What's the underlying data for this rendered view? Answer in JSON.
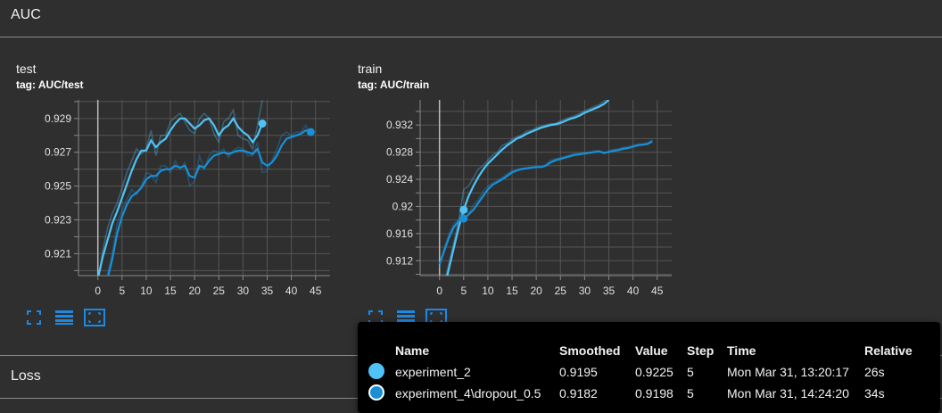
{
  "sections": {
    "auc_title": "AUC",
    "loss_title": "Loss"
  },
  "cards": [
    {
      "title": "test",
      "tag": "tag: AUC/test",
      "chart_data": {
        "type": "line",
        "xlim": [
          -4,
          48
        ],
        "ylim": [
          0.9197,
          0.9301
        ],
        "x_ticks": [
          0,
          5,
          10,
          15,
          20,
          25,
          30,
          35,
          40,
          45
        ],
        "y_ticks": [
          0.921,
          0.923,
          0.925,
          0.927,
          0.929
        ],
        "y_tick_labels": [
          "0.921",
          "0.923",
          "0.925",
          "0.927",
          "0.929"
        ],
        "grid": true,
        "series": [
          {
            "color": "#4fc3f7",
            "x": [
              0,
              1,
              2,
              3,
              4,
              5,
              6,
              7,
              8,
              9,
              10,
              11,
              12,
              13,
              14,
              15,
              16,
              17,
              18,
              19,
              20,
              21,
              22,
              23,
              24,
              25,
              26,
              27,
              28,
              29,
              30,
              31,
              32,
              33,
              34
            ],
            "smoothed": [
              0.9195,
              0.9208,
              0.9218,
              0.9228,
              0.9235,
              0.9243,
              0.9251,
              0.9259,
              0.9266,
              0.9271,
              0.9271,
              0.9277,
              0.9273,
              0.9276,
              0.9278,
              0.9283,
              0.9287,
              0.929,
              0.929,
              0.9287,
              0.9284,
              0.9286,
              0.9289,
              0.929,
              0.9286,
              0.928,
              0.9284,
              0.9286,
              0.929,
              0.9285,
              0.9282,
              0.928,
              0.9276,
              0.928,
              0.9287
            ],
            "raw": [
              0.9192,
              0.9212,
              0.9225,
              0.9234,
              0.924,
              0.9249,
              0.9258,
              0.9265,
              0.9272,
              0.9269,
              0.9272,
              0.9283,
              0.9268,
              0.928,
              0.928,
              0.9288,
              0.9291,
              0.9293,
              0.9288,
              0.9283,
              0.9281,
              0.929,
              0.9293,
              0.929,
              0.9281,
              0.9276,
              0.9288,
              0.929,
              0.9295,
              0.928,
              0.9278,
              0.9277,
              0.9272,
              0.9286,
              0.9301
            ],
            "marker_x": 34,
            "marker_y": 0.9287
          },
          {
            "color": "#1a8fd6",
            "x": [
              0,
              1,
              2,
              3,
              4,
              5,
              6,
              7,
              8,
              9,
              10,
              11,
              12,
              13,
              14,
              15,
              16,
              17,
              18,
              19,
              20,
              21,
              22,
              23,
              24,
              25,
              26,
              27,
              28,
              29,
              30,
              31,
              32,
              33,
              34,
              35,
              36,
              37,
              38,
              39,
              40,
              41,
              42,
              43,
              44
            ],
            "smoothed": [
              0.9165,
              0.9182,
              0.9195,
              0.9207,
              0.9222,
              0.9232,
              0.9239,
              0.9244,
              0.9246,
              0.9249,
              0.9254,
              0.9256,
              0.9256,
              0.9259,
              0.926,
              0.926,
              0.9262,
              0.9261,
              0.9262,
              0.9256,
              0.9255,
              0.9262,
              0.9261,
              0.9265,
              0.9268,
              0.9269,
              0.927,
              0.9269,
              0.927,
              0.9271,
              0.9271,
              0.927,
              0.9269,
              0.9272,
              0.9264,
              0.9262,
              0.9264,
              0.9268,
              0.9274,
              0.9278,
              0.9279,
              0.928,
              0.9281,
              0.9283,
              0.9282
            ],
            "raw": [
              0.9158,
              0.9186,
              0.9198,
              0.921,
              0.9228,
              0.9236,
              0.9242,
              0.9248,
              0.9245,
              0.925,
              0.9258,
              0.9257,
              0.9252,
              0.9262,
              0.9262,
              0.9258,
              0.9265,
              0.926,
              0.9264,
              0.925,
              0.9253,
              0.9268,
              0.926,
              0.9268,
              0.9271,
              0.927,
              0.9272,
              0.9267,
              0.9271,
              0.9273,
              0.9272,
              0.9268,
              0.9268,
              0.9276,
              0.9258,
              0.9259,
              0.9265,
              0.9272,
              0.928,
              0.9282,
              0.928,
              0.9282,
              0.9282,
              0.9286,
              0.928
            ],
            "marker_x": 44,
            "marker_y": 0.9282
          }
        ]
      }
    },
    {
      "title": "train",
      "tag": "tag: AUC/train",
      "chart_data": {
        "type": "line",
        "xlim": [
          -4,
          48
        ],
        "ylim": [
          0.9098,
          0.9357
        ],
        "x_ticks": [
          0,
          5,
          10,
          15,
          20,
          25,
          30,
          35,
          40,
          45
        ],
        "y_ticks": [
          0.912,
          0.916,
          0.92,
          0.924,
          0.928,
          0.932
        ],
        "y_tick_labels": [
          "0.912",
          "0.916",
          "0.92",
          "0.924",
          "0.928",
          "0.932"
        ],
        "grid": true,
        "series": [
          {
            "color": "#4fc3f7",
            "x": [
              0,
              1,
              2,
              3,
              4,
              5,
              6,
              7,
              8,
              9,
              10,
              11,
              12,
              13,
              14,
              15,
              16,
              17,
              18,
              19,
              20,
              21,
              22,
              23,
              24,
              25,
              26,
              27,
              28,
              29,
              30,
              31,
              32,
              33,
              34,
              35
            ],
            "smoothed": [
              0.905,
              0.908,
              0.911,
              0.914,
              0.917,
              0.9195,
              0.9215,
              0.923,
              0.9243,
              0.9254,
              0.9263,
              0.927,
              0.9277,
              0.9284,
              0.929,
              0.9295,
              0.93,
              0.9303,
              0.9307,
              0.931,
              0.9313,
              0.9316,
              0.9318,
              0.932,
              0.9321,
              0.9323,
              0.9326,
              0.9329,
              0.9331,
              0.9334,
              0.9338,
              0.9341,
              0.9344,
              0.9347,
              0.9351,
              0.9357
            ],
            "raw": [
              0.9045,
              0.9088,
              0.9118,
              0.9148,
              0.918,
              0.9225,
              0.923,
              0.9242,
              0.9255,
              0.926,
              0.9268,
              0.9276,
              0.928,
              0.929,
              0.9293,
              0.9299,
              0.9303,
              0.9305,
              0.9311,
              0.9312,
              0.9316,
              0.9318,
              0.932,
              0.9322,
              0.9322,
              0.9326,
              0.9329,
              0.9331,
              0.9334,
              0.9337,
              0.9341,
              0.9344,
              0.9347,
              0.935,
              0.9355,
              0.936
            ],
            "marker_x": 5,
            "marker_y": 0.9195
          },
          {
            "color": "#1a8fd6",
            "x": [
              0,
              1,
              2,
              3,
              4,
              5,
              6,
              7,
              8,
              9,
              10,
              11,
              12,
              13,
              14,
              15,
              16,
              17,
              18,
              19,
              20,
              21,
              22,
              23,
              24,
              25,
              26,
              27,
              28,
              29,
              30,
              31,
              32,
              33,
              34,
              35,
              36,
              37,
              38,
              39,
              40,
              41,
              42,
              43,
              44
            ],
            "smoothed": [
              0.9115,
              0.9135,
              0.9155,
              0.917,
              0.9178,
              0.9182,
              0.9188,
              0.9195,
              0.9205,
              0.9215,
              0.9225,
              0.9232,
              0.9236,
              0.924,
              0.9245,
              0.925,
              0.9253,
              0.9255,
              0.9256,
              0.9257,
              0.9258,
              0.9258,
              0.926,
              0.9265,
              0.9268,
              0.927,
              0.9272,
              0.9274,
              0.9276,
              0.9277,
              0.9278,
              0.9279,
              0.928,
              0.9281,
              0.9279,
              0.928,
              0.9282,
              0.9283,
              0.9285,
              0.9286,
              0.9288,
              0.929,
              0.9291,
              0.9292,
              0.9296
            ],
            "raw": [
              0.911,
              0.914,
              0.916,
              0.9175,
              0.918,
              0.9198,
              0.919,
              0.9202,
              0.921,
              0.9222,
              0.923,
              0.9235,
              0.9238,
              0.9243,
              0.9248,
              0.9253,
              0.9255,
              0.9256,
              0.9257,
              0.9258,
              0.9259,
              0.9258,
              0.9262,
              0.9268,
              0.927,
              0.9272,
              0.9274,
              0.9276,
              0.9278,
              0.9278,
              0.9279,
              0.928,
              0.9282,
              0.9282,
              0.9278,
              0.9282,
              0.9284,
              0.9285,
              0.9287,
              0.9288,
              0.929,
              0.9292,
              0.9292,
              0.9294,
              0.9298
            ],
            "marker_x": 5,
            "marker_y": 0.9182
          }
        ]
      }
    }
  ],
  "tooltip": {
    "headers": [
      "Name",
      "Smoothed",
      "Value",
      "Step",
      "Time",
      "Relative"
    ],
    "rows": [
      {
        "color": "#4fc3f7",
        "name": "experiment_2",
        "smoothed": "0.9195",
        "value": "0.9225",
        "step": "5",
        "time": "Mon Mar 31, 13:20:17",
        "relative": "26s"
      },
      {
        "color": "#1a8fd6",
        "name": "experiment_4\\dropout_0.5",
        "smoothed": "0.9182",
        "value": "0.9198",
        "step": "5",
        "time": "Mon Mar 31, 14:24:20",
        "relative": "34s"
      }
    ]
  },
  "icons": [
    "fullscreen-icon",
    "toggle-log-scale-icon",
    "fit-domain-icon"
  ]
}
